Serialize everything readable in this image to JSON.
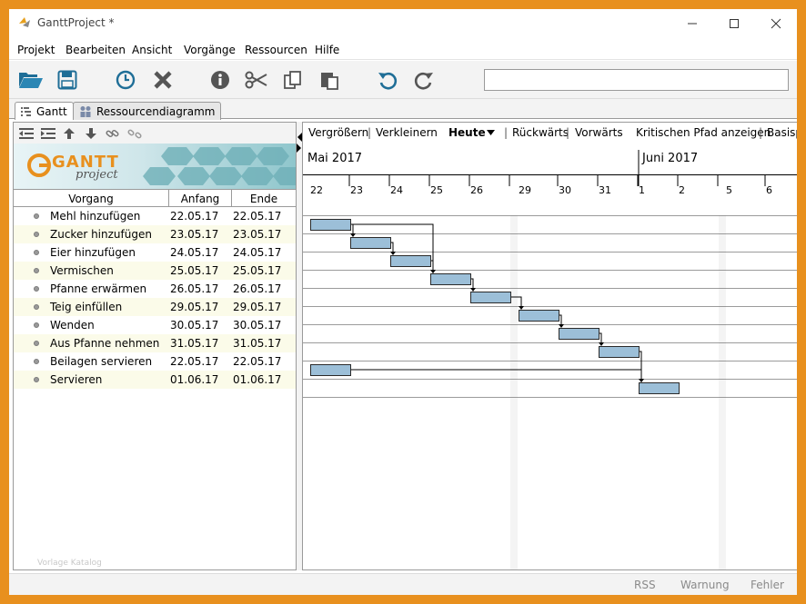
{
  "window": {
    "title": "GanttProject *"
  },
  "menu": [
    "Projekt",
    "Bearbeiten",
    "Ansicht",
    "Vorgänge",
    "Ressourcen",
    "Hilfe"
  ],
  "tabs": [
    {
      "label": "Gantt",
      "active": true
    },
    {
      "label": "Ressourcendiagramm",
      "active": false
    }
  ],
  "logo": {
    "main": "GANTT",
    "sub": "project"
  },
  "columns": {
    "task": "Vorgang",
    "start": "Anfang",
    "end": "Ende"
  },
  "tasks": [
    {
      "name": "Mehl hinzufügen",
      "start": "22.05.17",
      "end": "22.05.17"
    },
    {
      "name": "Zucker hinzufügen",
      "start": "23.05.17",
      "end": "23.05.17"
    },
    {
      "name": "Eier hinzufügen",
      "start": "24.05.17",
      "end": "24.05.17"
    },
    {
      "name": "Vermischen",
      "start": "25.05.17",
      "end": "25.05.17"
    },
    {
      "name": "Pfanne erwärmen",
      "start": "26.05.17",
      "end": "26.05.17"
    },
    {
      "name": "Teig einfüllen",
      "start": "29.05.17",
      "end": "29.05.17"
    },
    {
      "name": "Wenden",
      "start": "30.05.17",
      "end": "30.05.17"
    },
    {
      "name": "Aus Pfanne nehmen",
      "start": "31.05.17",
      "end": "31.05.17"
    },
    {
      "name": "Beilagen servieren",
      "start": "22.05.17",
      "end": "22.05.17"
    },
    {
      "name": "Servieren",
      "start": "01.06.17",
      "end": "01.06.17"
    }
  ],
  "watermark": "Vorlage Katalog",
  "chart_toolbar": {
    "zoom_in": "Vergrößern",
    "zoom_out": "Verkleinern",
    "today": "Heute",
    "back": "Rückwärts",
    "forward": "Vorwärts",
    "critical_path": "Kritischen Pfad anzeigen",
    "baseline": "Basisp"
  },
  "timeline": {
    "months": [
      "Mai 2017",
      "Juni 2017"
    ],
    "days": [
      "22",
      "23",
      "24",
      "25",
      "26",
      "29",
      "30",
      "31",
      "1",
      "2",
      "5",
      "6"
    ]
  },
  "dependencies": [
    [
      0,
      1
    ],
    [
      1,
      2
    ],
    [
      2,
      3
    ],
    [
      0,
      3
    ],
    [
      3,
      4
    ],
    [
      4,
      5
    ],
    [
      5,
      6
    ],
    [
      6,
      7
    ],
    [
      7,
      9
    ],
    [
      8,
      9
    ]
  ],
  "status": {
    "rss": "RSS",
    "warning": "Warnung",
    "error": "Fehler"
  },
  "colors": {
    "bar_fill": "#9cbfd8",
    "bar_border": "#2a2a2a",
    "frame": "#e8901e",
    "row_alt": "#fbfbe9"
  }
}
